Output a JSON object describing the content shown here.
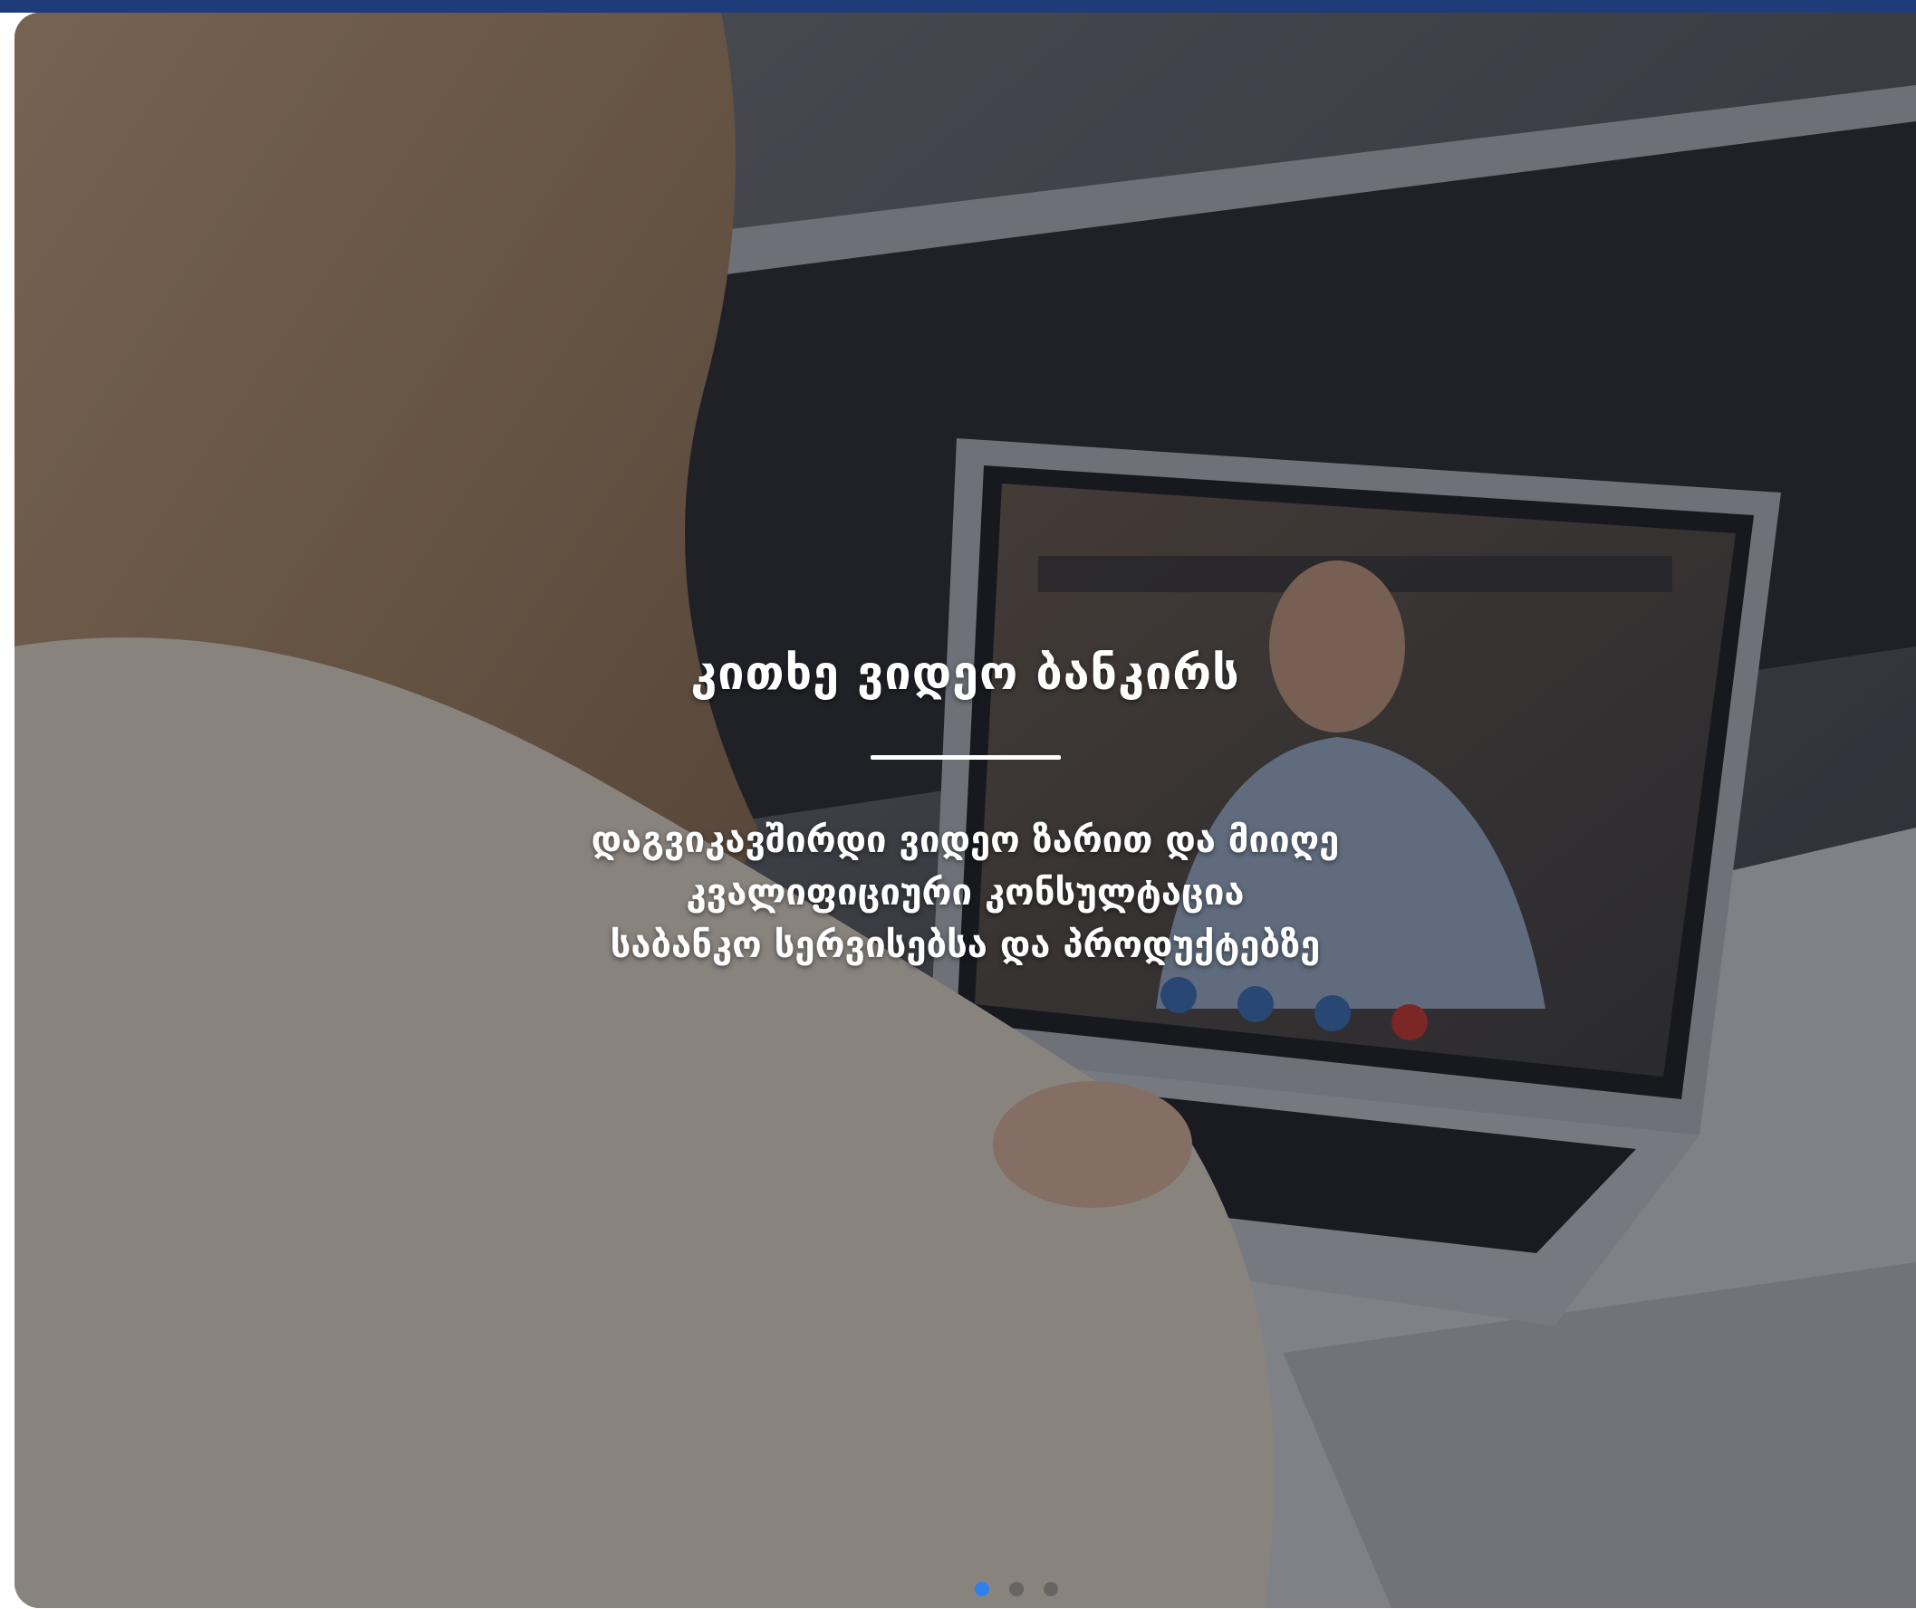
{
  "hero": {
    "title": "კითხე ვიდეო ბანკირს",
    "description_lines": [
      "დაგვიკავშირდი ვიდეო ზარით და მიიღე",
      "კვალიფიციური კონსულტაცია",
      "საბანკო სერვისებსა და პროდუქტებზე"
    ]
  },
  "carousel": {
    "slide_count": 3,
    "active_index": 0
  },
  "colors": {
    "top_bar": "#1f3c7a",
    "active_dot": "#2f80ed"
  }
}
